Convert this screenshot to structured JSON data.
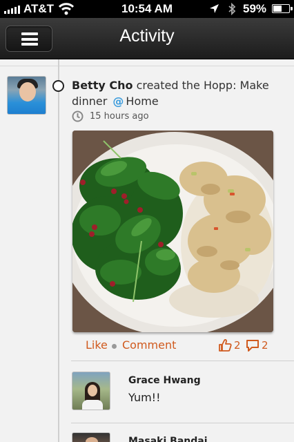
{
  "status_bar": {
    "carrier": "AT&T",
    "time": "10:54 AM",
    "battery_percent": "59%",
    "battery_level": 0.59,
    "icons": [
      "signal-icon",
      "wifi-icon",
      "location-icon",
      "bluetooth-icon",
      "battery-icon"
    ]
  },
  "nav": {
    "title": "Activity",
    "menu_icon": "hamburger-menu-icon"
  },
  "activity": {
    "user_name": "Betty Cho",
    "action_text": "created the Hopp: Make dinner",
    "at_symbol": "@",
    "location": "Home",
    "time_ago": "15 hours ago",
    "time_icon": "clock-icon",
    "like_label": "Like",
    "comment_label": "Comment",
    "like_count": "2",
    "comment_count": "2",
    "like_icon": "thumbs-up-icon",
    "comment_icon": "speech-bubble-icon"
  },
  "comments": [
    {
      "name": "Grace Hwang",
      "text": "Yum!!"
    },
    {
      "name": "Masaki Bandai",
      "text": ""
    }
  ],
  "colors": {
    "accent": "#d05a1e",
    "at_symbol": "#3a9bdc",
    "nav_bg": "#2b2b2b",
    "page_bg": "#f2f2f2"
  }
}
